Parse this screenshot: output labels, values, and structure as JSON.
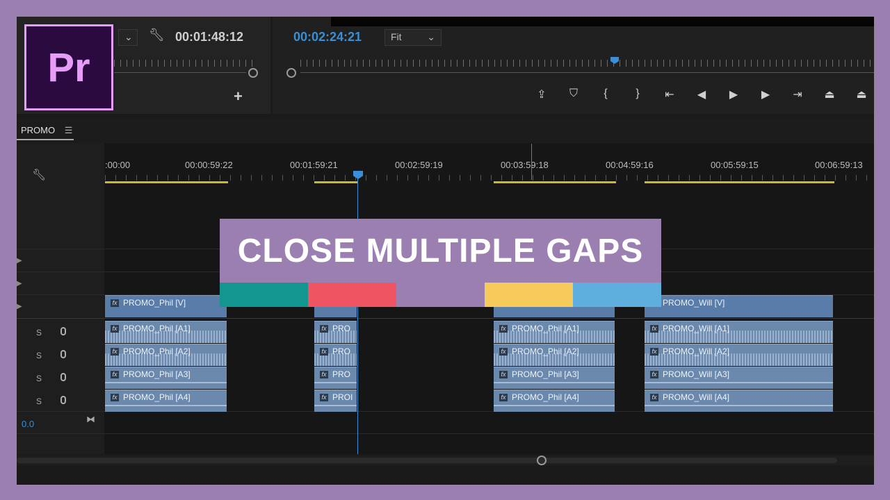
{
  "app": {
    "logo_text": "Pr",
    "brand_color": "#e59df8",
    "frame_color": "#9b7fb1"
  },
  "source_monitor": {
    "timecode": "00:01:48:12",
    "wrench_icon": "wrench-icon",
    "add_button_label": "+"
  },
  "program_monitor": {
    "timecode": "00:02:24:21",
    "zoom_select": "Fit",
    "controls": [
      {
        "name": "export-frame-icon",
        "glyph": "⇪"
      },
      {
        "name": "add-marker-icon",
        "glyph": "⛉"
      },
      {
        "name": "mark-in-icon",
        "glyph": "{"
      },
      {
        "name": "mark-out-icon",
        "glyph": "}"
      },
      {
        "name": "go-to-in-icon",
        "glyph": "⇤"
      },
      {
        "name": "step-back-icon",
        "glyph": "◀"
      },
      {
        "name": "play-icon",
        "glyph": "▶"
      },
      {
        "name": "step-forward-icon",
        "glyph": "▶"
      },
      {
        "name": "go-to-out-icon",
        "glyph": "⇥"
      },
      {
        "name": "lift-icon",
        "glyph": "⏏"
      },
      {
        "name": "extract-icon",
        "glyph": "⏏"
      }
    ]
  },
  "sequence": {
    "tab_label": "PROMO",
    "menu_icon": "☰",
    "ruler_labels": [
      ":00:00",
      "00:00:59:22",
      "00:01:59:21",
      "00:02:59:19",
      "00:03:59:18",
      "00:04:59:16",
      "00:05:59:15",
      "00:06:59:13"
    ],
    "volume_value": "0.0",
    "audio_track_labels": [
      "S",
      "S",
      "S",
      "S"
    ]
  },
  "clips": {
    "phil_v": "PROMO_Phil [V]",
    "phil_a1": "PROMO_Phil [A1]",
    "phil_a2": "PROMO_Phil [A2]",
    "phil_a3": "PROMO_Phil [A3]",
    "phil_a4": "PROMO_Phil [A4]",
    "prom_short": "PRO",
    "prom_short_a4": "PROI",
    "will_v": "PROMO_Will [V]",
    "will_a1": "PROMO_Will [A1]",
    "will_a2": "PROMO_Will [A2]",
    "will_a3": "PROMO_Will [A3]",
    "will_a4": "PROMO_Will [A4]",
    "fx_badge": "fx"
  },
  "banner": {
    "title": "CLOSE MULTIPLE GAPS",
    "stripe_colors": [
      "#13968f",
      "#ef5462",
      "#9b7fb1",
      "#f7cb5b",
      "#5eaede"
    ]
  }
}
